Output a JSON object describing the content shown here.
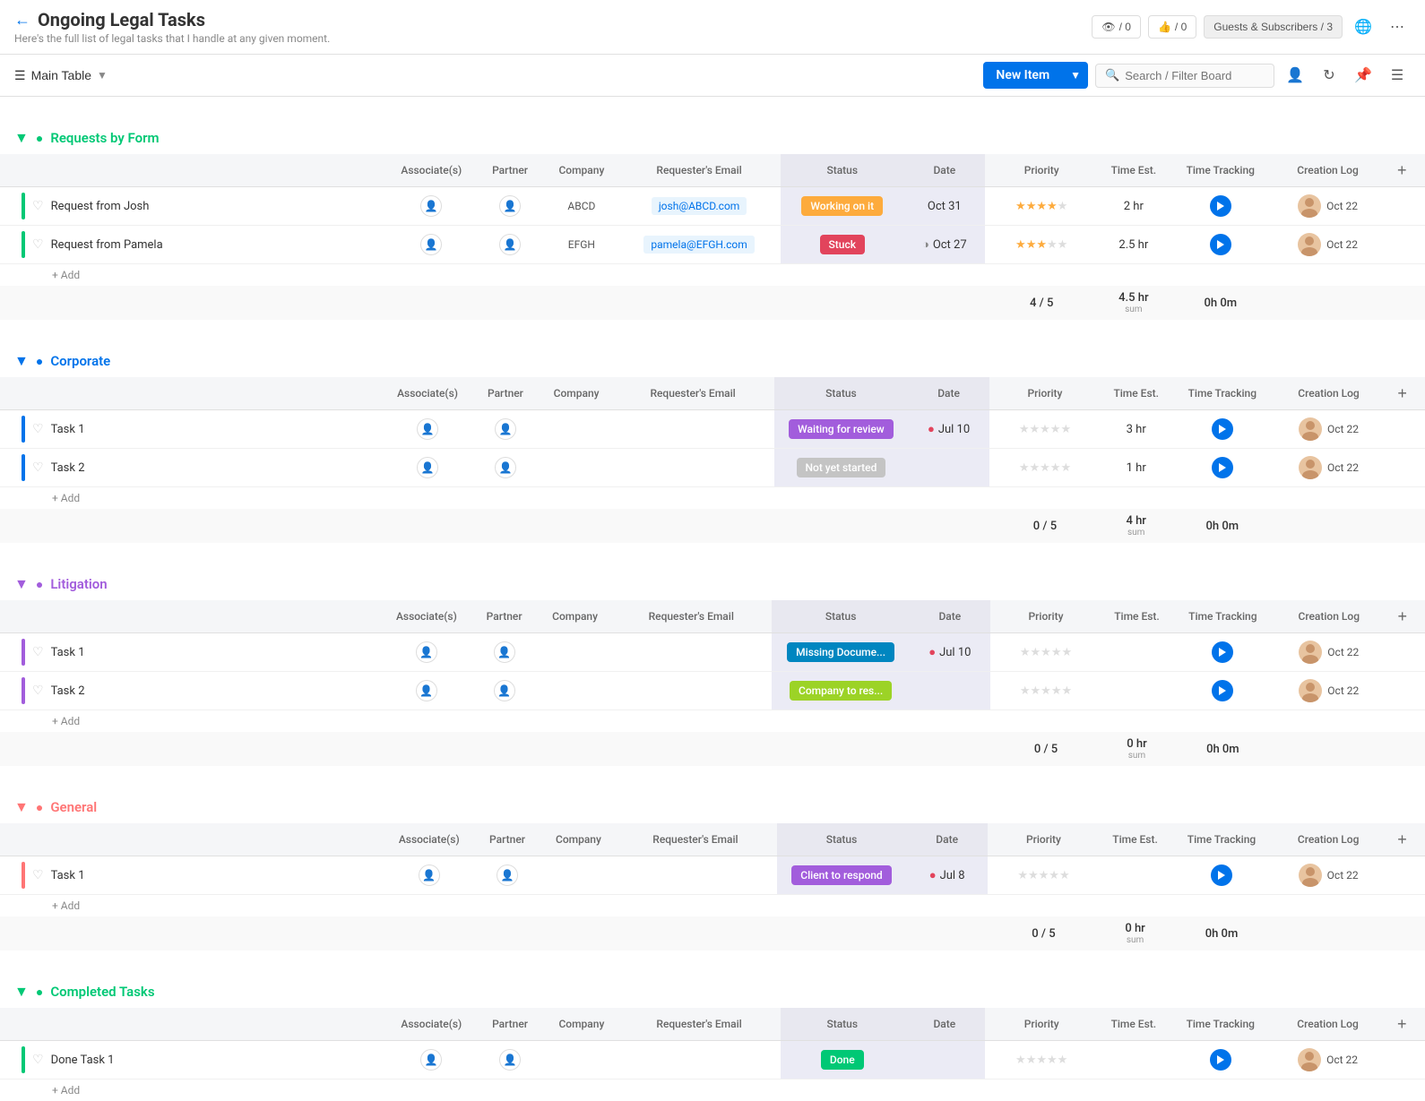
{
  "header": {
    "title": "Ongoing Legal Tasks",
    "subtitle": "Here's the full list of legal tasks that I handle at any given moment.",
    "views_count": "/ 0",
    "likes_count": "/ 0",
    "guests_label": "Guests & Subscribers / 3"
  },
  "toolbar": {
    "table_label": "Main Table",
    "new_item_label": "New Item",
    "search_placeholder": "Search / Filter Board"
  },
  "groups": [
    {
      "id": "requests",
      "title": "Requests by Form",
      "color": "#00c875",
      "icon_char": "✓",
      "color_class": "group-green",
      "bar_color": "#00c875",
      "rows": [
        {
          "name": "Request from Josh",
          "email": "josh@ABCD.com",
          "company": "ABCD",
          "status": "Working on it",
          "status_class": "status-working",
          "date": "Oct 31",
          "date_icon": "",
          "priority_filled": 4,
          "priority_empty": 1,
          "time_est": "2 hr",
          "creation_date": "Oct 22"
        },
        {
          "name": "Request from Pamela",
          "email": "pamela@EFGH.com",
          "company": "EFGH",
          "status": "Stuck",
          "status_class": "status-stuck",
          "date": "Oct 27",
          "date_icon": "half",
          "priority_filled": 3,
          "priority_empty": 2,
          "time_est": "2.5 hr",
          "creation_date": "Oct 22"
        }
      ],
      "summary": {
        "priority": "4 / 5",
        "time_est": "4.5 hr",
        "time_est_label": "sum",
        "time_track": "0h 0m"
      }
    },
    {
      "id": "corporate",
      "title": "Corporate",
      "color": "#0073ea",
      "icon_char": "○",
      "color_class": "group-blue",
      "bar_color": "#0073ea",
      "rows": [
        {
          "name": "Task 1",
          "email": "",
          "company": "",
          "status": "Waiting for review",
          "status_class": "status-waiting",
          "date": "Jul 10",
          "date_icon": "alert",
          "priority_filled": 0,
          "priority_empty": 5,
          "time_est": "3 hr",
          "creation_date": "Oct 22"
        },
        {
          "name": "Task 2",
          "email": "",
          "company": "",
          "status": "Not yet started",
          "status_class": "status-not-started",
          "date": "",
          "date_icon": "",
          "priority_filled": 0,
          "priority_empty": 5,
          "time_est": "1 hr",
          "creation_date": "Oct 22"
        }
      ],
      "summary": {
        "priority": "0 / 5",
        "time_est": "4 hr",
        "time_est_label": "sum",
        "time_track": "0h 0m"
      }
    },
    {
      "id": "litigation",
      "title": "Litigation",
      "color": "#a25ddc",
      "icon_char": "○",
      "color_class": "group-purple",
      "bar_color": "#a25ddc",
      "rows": [
        {
          "name": "Task 1",
          "email": "",
          "company": "",
          "status": "Missing Docume...",
          "status_class": "status-missing",
          "date": "Jul 10",
          "date_icon": "alert",
          "priority_filled": 0,
          "priority_empty": 5,
          "time_est": "",
          "creation_date": "Oct 22"
        },
        {
          "name": "Task 2",
          "email": "",
          "company": "",
          "status": "Company to res...",
          "status_class": "status-company",
          "date": "",
          "date_icon": "",
          "priority_filled": 0,
          "priority_empty": 5,
          "time_est": "",
          "creation_date": "Oct 22"
        }
      ],
      "summary": {
        "priority": "0 / 5",
        "time_est": "0 hr",
        "time_est_label": "sum",
        "time_track": "0h 0m"
      }
    },
    {
      "id": "general",
      "title": "General",
      "color": "#ff7575",
      "icon_char": "○",
      "color_class": "group-orange",
      "bar_color": "#ff7575",
      "rows": [
        {
          "name": "Task 1",
          "email": "",
          "company": "",
          "status": "Client to respond",
          "status_class": "status-client",
          "date": "Jul 8",
          "date_icon": "alert",
          "priority_filled": 0,
          "priority_empty": 5,
          "time_est": "",
          "creation_date": "Oct 22"
        }
      ],
      "summary": {
        "priority": "0 / 5",
        "time_est": "0 hr",
        "time_est_label": "sum",
        "time_track": "0h 0m"
      }
    },
    {
      "id": "completed",
      "title": "Completed Tasks",
      "color": "#00c875",
      "icon_char": "✓",
      "color_class": "group-teal",
      "bar_color": "#00c875",
      "rows": [
        {
          "name": "Done Task 1",
          "email": "",
          "company": "",
          "status": "Done",
          "status_class": "status-done",
          "date": "",
          "date_icon": "",
          "priority_filled": 0,
          "priority_empty": 5,
          "time_est": "",
          "creation_date": "Oct 22"
        }
      ],
      "summary": null
    }
  ],
  "col_headers": {
    "associates": "Associate(s)",
    "partner": "Partner",
    "company": "Company",
    "email": "Requester's Email",
    "status": "Status",
    "date": "Date",
    "priority": "Priority",
    "time_est": "Time Est.",
    "time_track": "Time Tracking",
    "creation": "Creation Log"
  },
  "add_label": "+ Add"
}
